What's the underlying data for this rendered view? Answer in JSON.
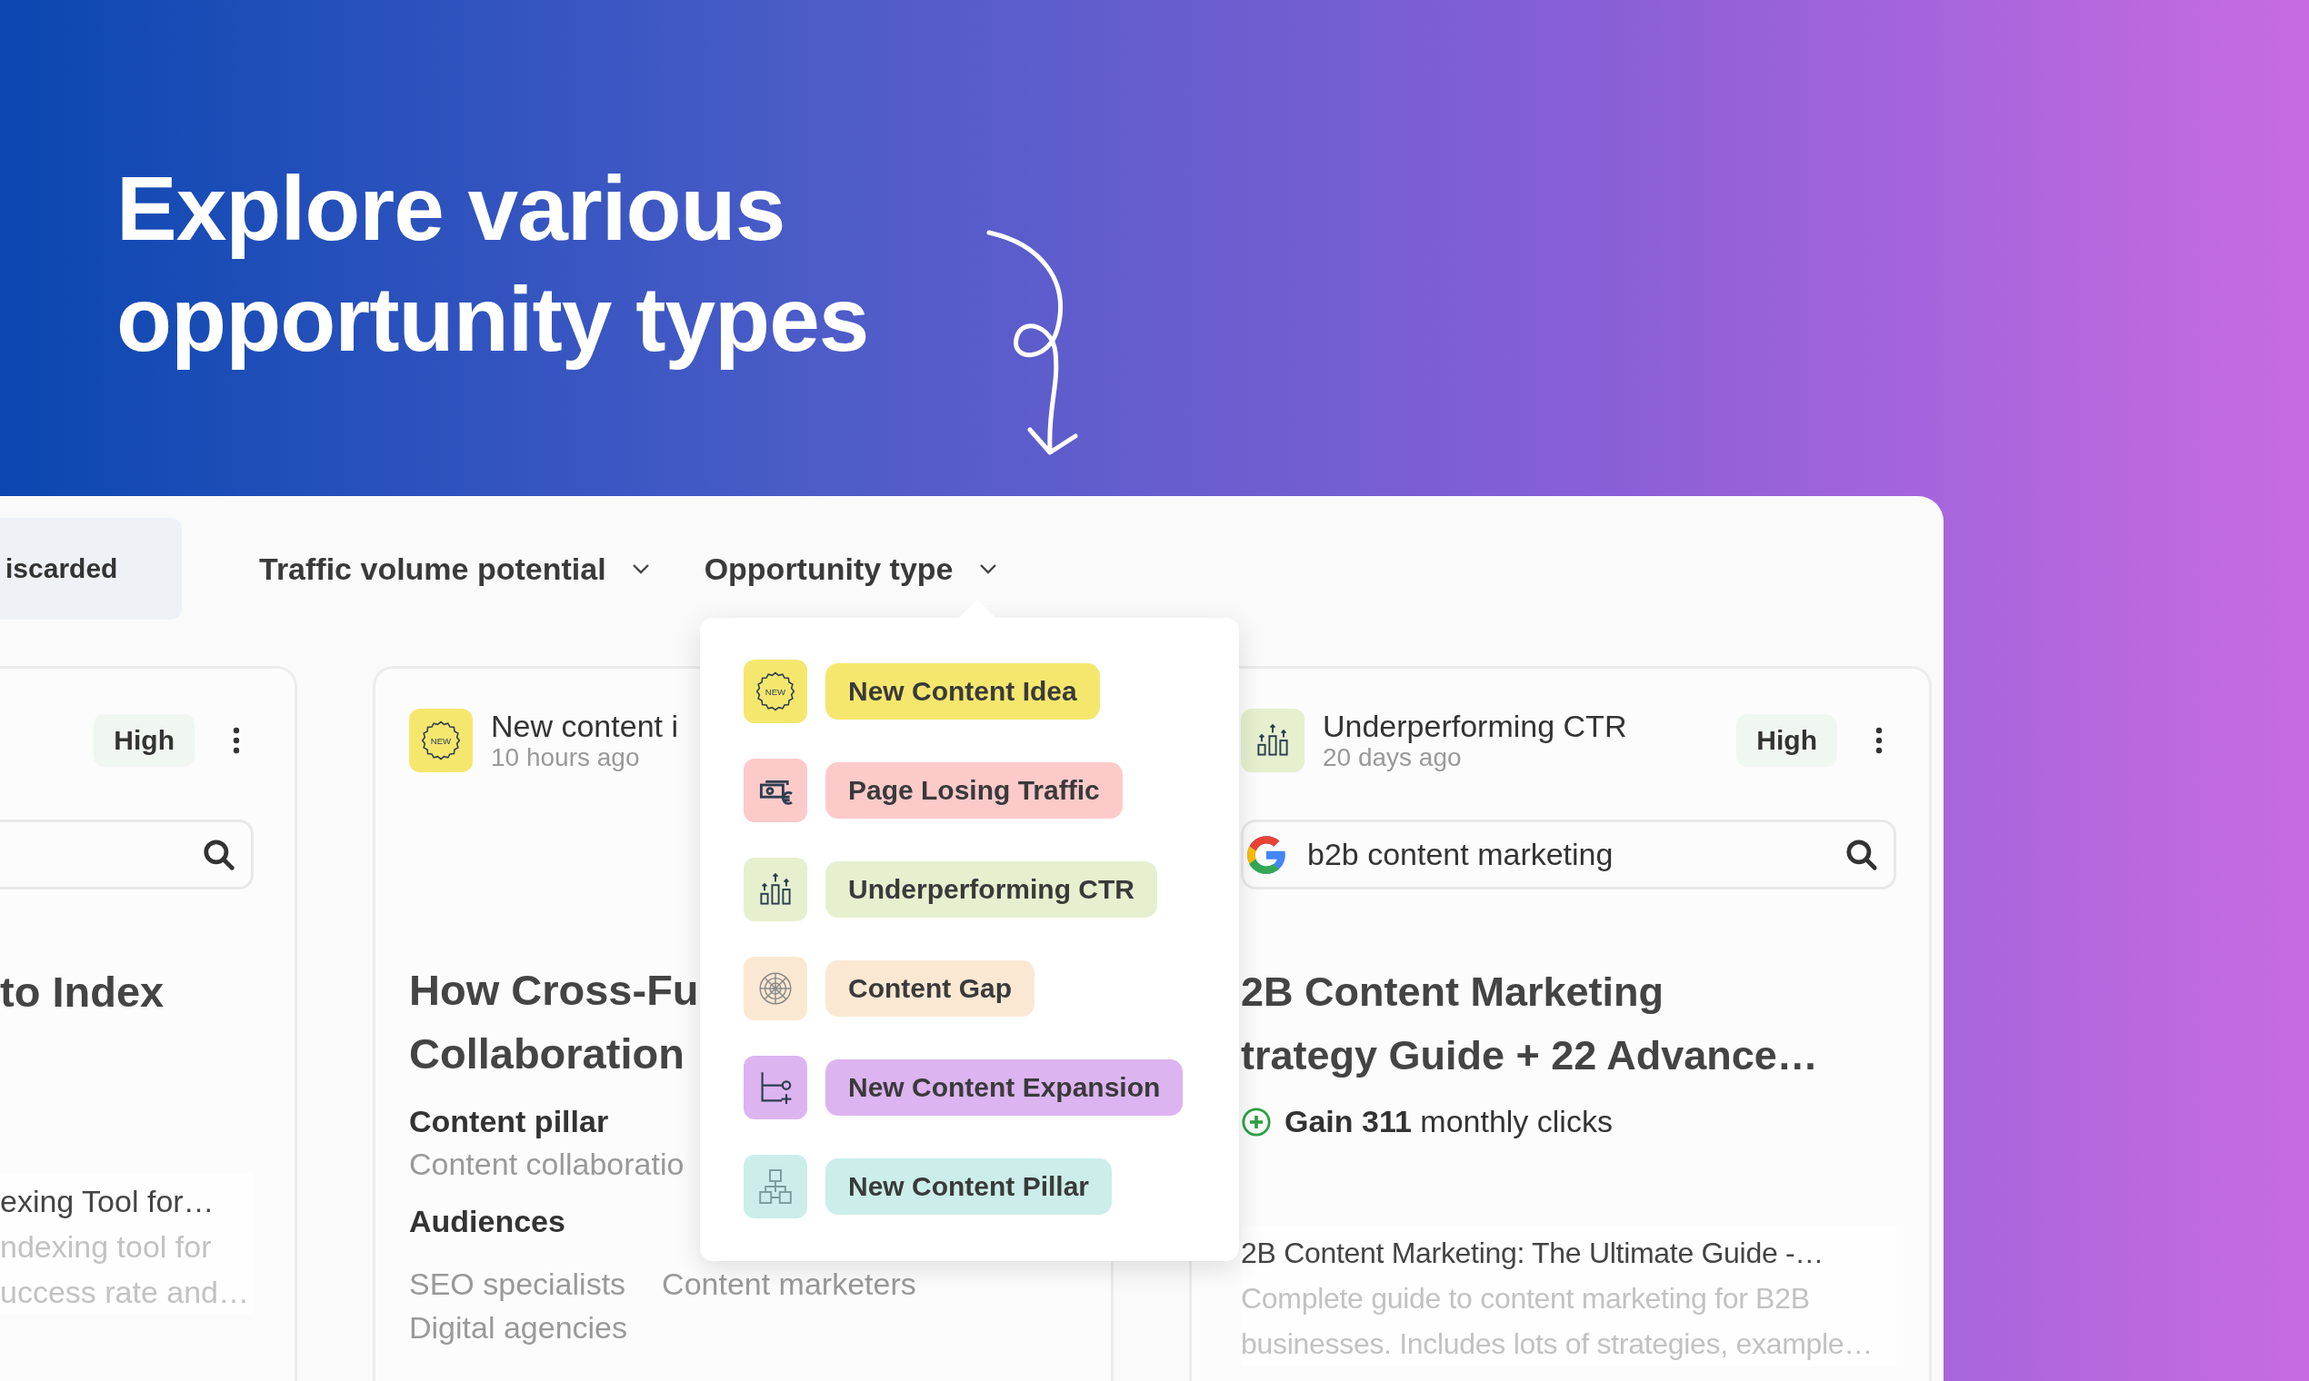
{
  "headline": [
    "Explore various",
    "opportunity types"
  ],
  "filters": {
    "tab": "iscarded",
    "dropdowns": [
      {
        "label": "Traffic volume potential"
      },
      {
        "label": "Opportunity type"
      }
    ]
  },
  "cards": [
    {
      "kind": "cut",
      "badge": "High",
      "title": [
        "to Index"
      ],
      "snippet": {
        "title": "exing Tool for…",
        "lines": [
          "ndexing tool for",
          "uccess rate and…"
        ]
      }
    },
    {
      "kind": "pillar",
      "type": {
        "label": "New content i",
        "time": "10 hours ago",
        "kind": "new",
        "icon_text": "NEW",
        "color": "#f5e76e"
      },
      "title": [
        "How Cross-Fu",
        "Collaboration"
      ],
      "pillar_label": "Content pillar",
      "pillar": "Content collaboratio",
      "audiences_label": "Audiences",
      "audiences": [
        "SEO specialists",
        "Content marketers",
        "Digital agencies"
      ]
    },
    {
      "kind": "keyword",
      "type": {
        "label": "Underperforming CTR",
        "time": "20 days ago",
        "kind": "chart",
        "color": "#e6f0cf"
      },
      "badge": "High",
      "keyword": "b2b content marketing",
      "title": [
        "2B Content Marketing",
        "trategy Guide + 22 Advance…"
      ],
      "gain": "**Gain 311** monthly clicks",
      "snippet": {
        "title": "2B Content Marketing: The Ultimate Guide -…",
        "lines": [
          "Complete guide to content marketing for B2B",
          "businesses. Includes lots of strategies, example…"
        ]
      }
    }
  ],
  "menu": {
    "items": [
      {
        "label": "New Content Idea",
        "kind": "new",
        "icon_text": "NEW",
        "color": "#f5e76e"
      },
      {
        "label": "Page Losing Traffic",
        "kind": "money",
        "color": "#fdcaca"
      },
      {
        "label": "Underperforming CTR",
        "kind": "chart",
        "color": "#e6f0cf"
      },
      {
        "label": "Content Gap",
        "kind": "web",
        "color": "#fbe8d3"
      },
      {
        "label": "New Content Expansion",
        "kind": "branch",
        "color": "#dcb4f0"
      },
      {
        "label": "New Content Pillar",
        "kind": "hierarchy",
        "color": "#cbeeea"
      }
    ]
  }
}
